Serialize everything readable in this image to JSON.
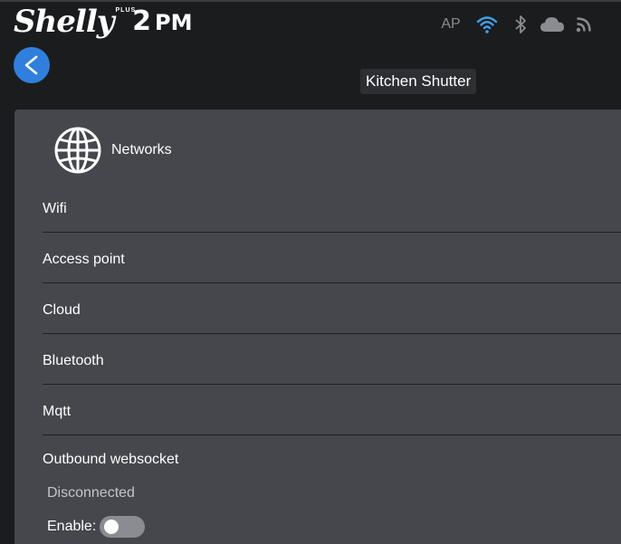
{
  "brand": {
    "logo_word": "Shelly",
    "logo_plus": "PLUS",
    "logo_model": "2",
    "logo_model_suffix": "PM"
  },
  "status": {
    "ap_label": "AP",
    "icons": [
      "wifi-icon",
      "bluetooth-icon",
      "cloud-icon",
      "rss-icon"
    ],
    "wifi_color": "#3fa0e8",
    "inactive_color": "#8b8d91"
  },
  "header": {
    "device_name": "Kitchen Shutter"
  },
  "panel": {
    "title": "Networks",
    "icon": "globe-icon",
    "items": [
      {
        "label": "Wifi"
      },
      {
        "label": "Access point"
      },
      {
        "label": "Cloud"
      },
      {
        "label": "Bluetooth"
      },
      {
        "label": "Mqtt"
      }
    ],
    "outbound_websocket": {
      "title": "Outbound websocket",
      "status": "Disconnected",
      "enable_label": "Enable:",
      "enabled": false
    }
  },
  "colors": {
    "accent": "#2f7fde",
    "panel_bg": "#45474c",
    "page_bg": "#1b1c1e"
  }
}
